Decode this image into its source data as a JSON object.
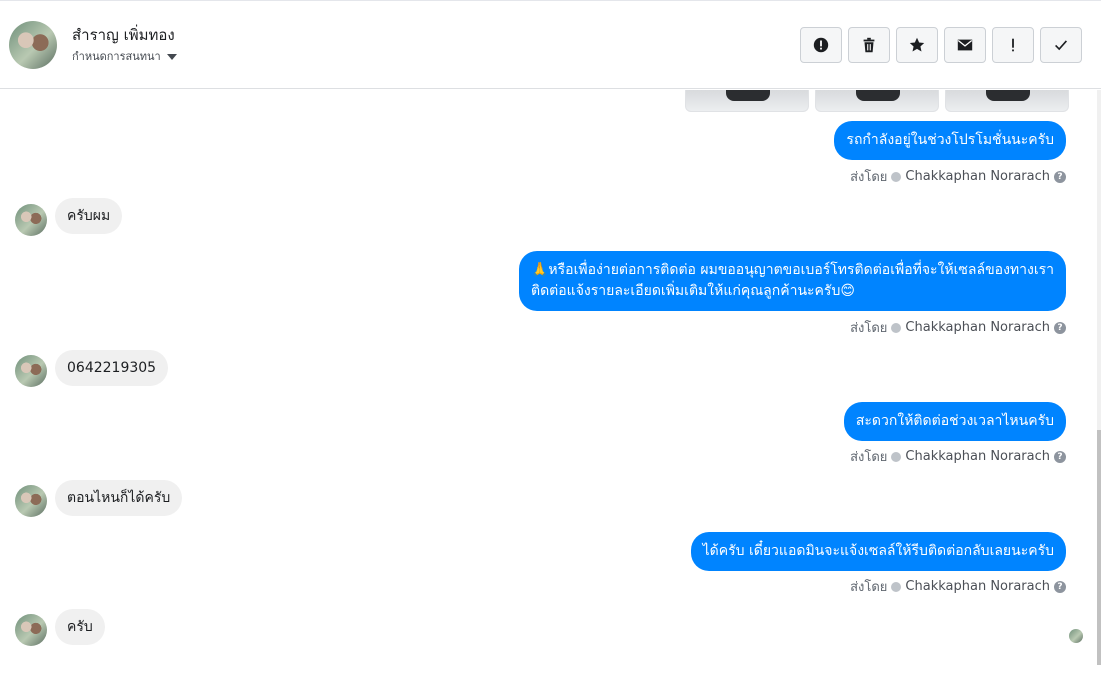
{
  "header": {
    "contact_name": "สำราญ เพิ่มทอง",
    "assign_label": "กำหนดการสนทนา"
  },
  "toolbar": {
    "buttons": [
      {
        "name": "report-spam",
        "icon": "alert-circle-icon"
      },
      {
        "name": "delete",
        "icon": "trash-icon"
      },
      {
        "name": "star",
        "icon": "star-icon"
      },
      {
        "name": "mark-unread",
        "icon": "envelope-icon"
      },
      {
        "name": "follow-up",
        "icon": "exclamation-icon"
      },
      {
        "name": "mark-done",
        "icon": "checkmark-icon"
      }
    ]
  },
  "messages": [
    {
      "from": "page",
      "text": "รถกำลังอยู่ในช่วงโปรโมชั่นนะครับ"
    },
    {
      "from": "customer",
      "text": "ครับผม"
    },
    {
      "from": "page",
      "lines": [
        "🙏หรือเพื่อง่ายต่อการติดต่อ ผมขออนุญาตขอเบอร์โทรติดต่อเพื่อที่จะให้เซลล์ของทางเรา",
        "ติดต่อแจ้งรายละเอียดเพิ่มเติมให้แก่คุณลูกค้านะครับ😊"
      ]
    },
    {
      "from": "customer",
      "text": "0642219305"
    },
    {
      "from": "page",
      "text": "สะดวกให้ติดต่อช่วงเวลาไหนครับ"
    },
    {
      "from": "customer",
      "text": "ตอนไหนก็ได้ครับ"
    },
    {
      "from": "page",
      "text": "ได้ครับ เดี๋ยวแอดมินจะแจ้งเซลล์ให้รีบติดต่อกลับเลยนะครับ"
    },
    {
      "from": "customer",
      "text": "ครับ"
    }
  ],
  "sent_by": {
    "prefix": "ส่งโดย",
    "agent": "Chakkaphan Norarach"
  }
}
